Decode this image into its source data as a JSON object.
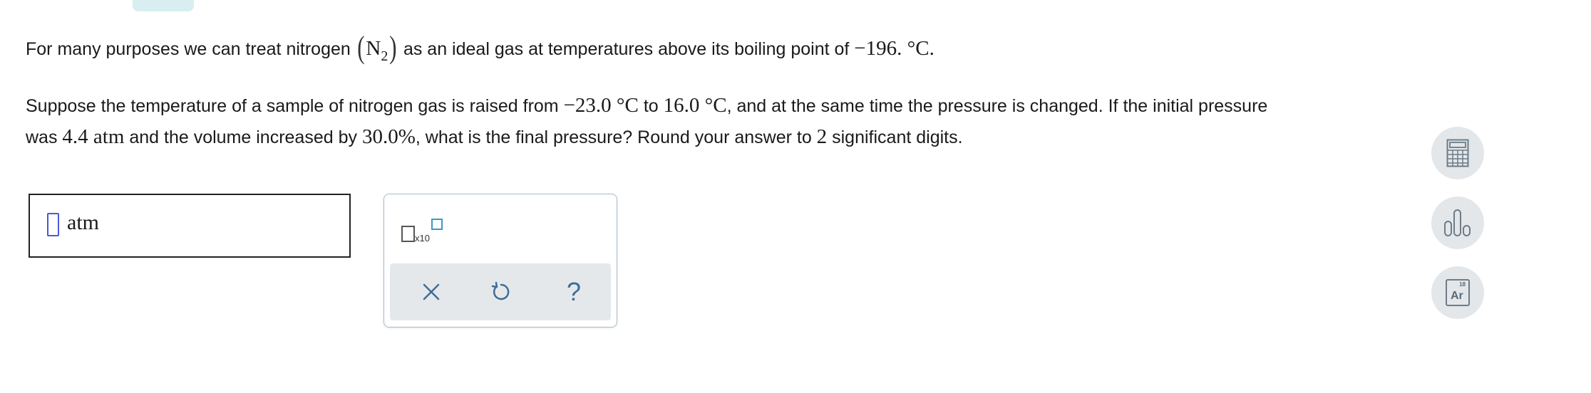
{
  "question": {
    "line1": {
      "before": "For many purposes we can treat nitrogen ",
      "formula_element": "N",
      "formula_subscript": "2",
      "middle": " as an ideal gas at temperatures above its boiling point of ",
      "boiling_point": "−196. °C",
      "end": "."
    },
    "line2": {
      "before": "Suppose the temperature of a sample of nitrogen gas is raised from ",
      "temp_initial": "−23.0 °C",
      "to": " to ",
      "temp_final": "16.0 °C",
      "after": ", and at the same time the pressure is changed. If the initial pressure"
    },
    "line3": {
      "before": "was ",
      "initial_pressure": "4.4 atm",
      "middle": " and the volume increased by ",
      "volume_increase": "30.0%",
      "after": ", what is the final pressure? Round your answer to ",
      "sig_digits": "2",
      "end": " significant digits."
    }
  },
  "answer": {
    "value": "",
    "unit": "atm"
  },
  "tools": {
    "sci_notation_label": "x10",
    "help_symbol": "?"
  },
  "sidebar": {
    "periodic_number": "18",
    "periodic_symbol": "Ar"
  },
  "colors": {
    "tab": "#d8eef1",
    "cursor": "#4a5ad8",
    "tool_icon": "#3f6e95",
    "sidebar_bg": "#e3e7ea",
    "tools_bar_bg": "#e5e8eb"
  }
}
